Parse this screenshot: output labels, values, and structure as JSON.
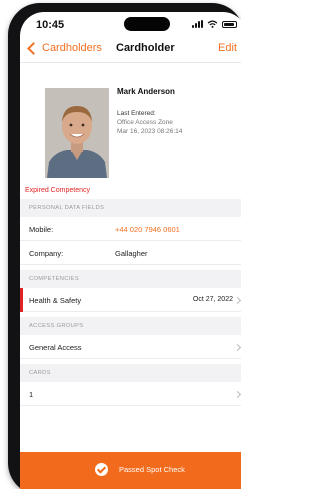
{
  "status_bar": {
    "time": "10:45"
  },
  "nav": {
    "back_label": "Cardholders",
    "title": "Cardholder",
    "edit_label": "Edit"
  },
  "profile": {
    "name": "Mark Anderson",
    "last_entered_label": "Last Entered:",
    "last_entered_zone": "Office Access Zone",
    "last_entered_time": "Mar 16, 2023 08:26:14"
  },
  "expired_label": "Expired Competency",
  "personal_data": {
    "header": "PERSONAL DATA FIELDS",
    "rows": [
      {
        "label": "Mobile:",
        "value": "+44 020 7946 0601"
      },
      {
        "label": "Company:",
        "value": "Gallagher"
      }
    ]
  },
  "competencies": {
    "header": "COMPETENCIES",
    "items": [
      {
        "label": "Health & Safety",
        "date": "Oct 27, 2022"
      }
    ]
  },
  "access_groups": {
    "header": "ACCESS GROUPS",
    "items": [
      {
        "label": "General Access"
      }
    ]
  },
  "cards": {
    "header": "CARDS",
    "items": [
      {
        "label": "1"
      }
    ]
  },
  "bottom_bar": {
    "label": "Passed Spot Check"
  },
  "colors": {
    "accent": "#f07023",
    "alert": "#e02424",
    "bottom_bar": "#f26a1b"
  }
}
